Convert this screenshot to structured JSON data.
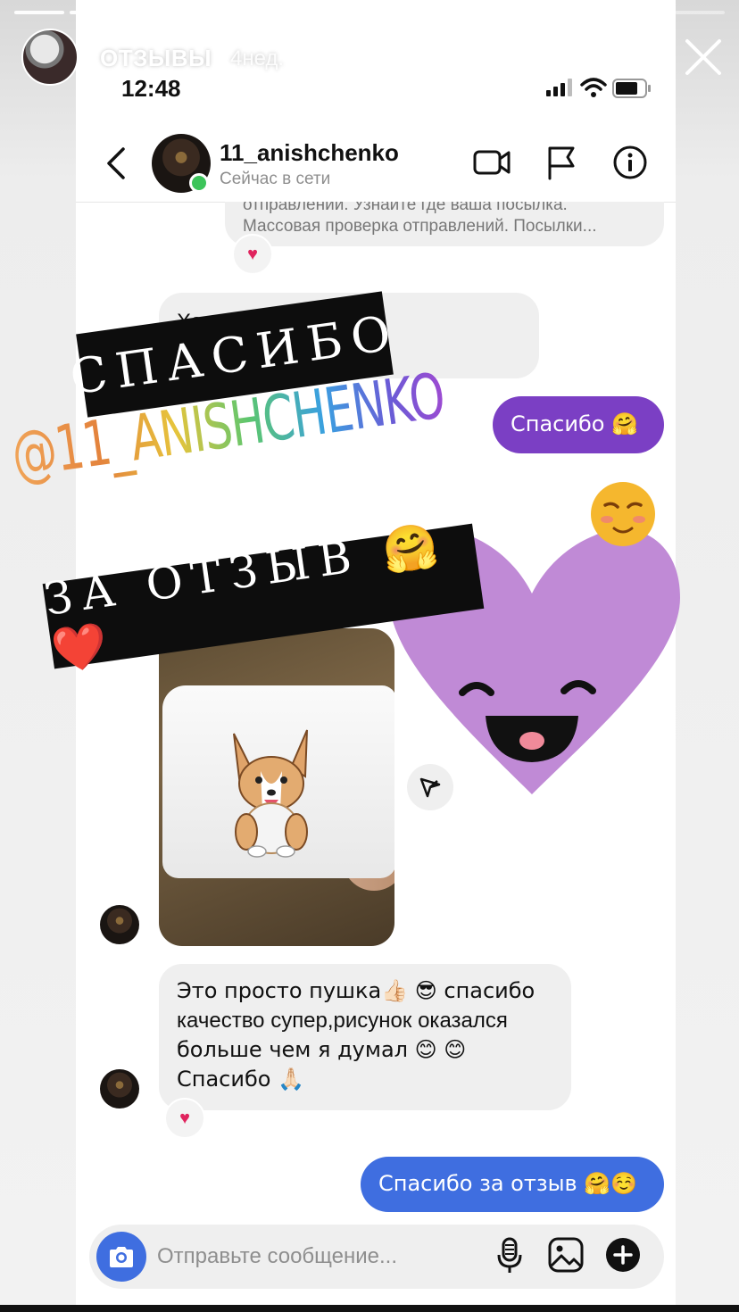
{
  "story": {
    "username": "ОТЗЫВЫ",
    "time_ago": "4нед.",
    "progress_segments": 13,
    "segments_done": 8,
    "current_segment_fraction": 0.2
  },
  "phone_status": {
    "clock": "12:48"
  },
  "chat": {
    "username": "11_anishchenko",
    "status": "Сейчас в сети"
  },
  "messages": {
    "quoted_line1": "отправлении. Узнайте где ваша посылка.",
    "quoted_line2": "Массовая проверка отправлений. Посылки...",
    "reaction_heart": "♥",
    "horosho": "Хорошо                    язательно",
    "spasibo": "Спасибо 🤗",
    "long_line1": "Это просто пушка👍🏻 😎 спасибо",
    "long_line2": "качество супер,рисунок оказался",
    "long_line3": "больше чем я думал 😊 😊",
    "long_line4": "Спасибо 🙏🏻",
    "thanks_review": "Спасибо за отзыв 🤗☺️"
  },
  "composer": {
    "placeholder": "Отправьте сообщение..."
  },
  "stickers": {
    "tag1": "СПАСИБО",
    "mention": "@11_ANISHCHENKO",
    "tag2": "ЗА ОТЗЫВ 🤗❤️"
  },
  "colors": {
    "outgoing_purple": "#7b3fc4",
    "outgoing_blue": "#3f6ee0",
    "incoming_gray": "#efefef",
    "heart_sticker": "#c08ad6",
    "online_green": "#3cc45a"
  }
}
